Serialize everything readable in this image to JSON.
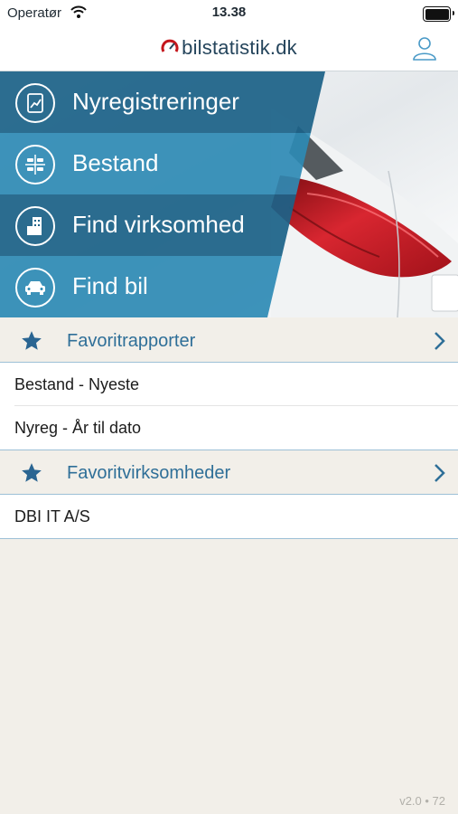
{
  "status_bar": {
    "carrier": "Operatør",
    "time": "13.38",
    "wifi_icon": "wifi-icon",
    "battery_icon": "battery-icon"
  },
  "nav": {
    "title": "bilstatistik.dk",
    "logo_icon": "speedometer-icon",
    "user_icon": "user-icon"
  },
  "menu": {
    "items": [
      {
        "label": "Nyregistreringer",
        "icon": "report-chart-icon"
      },
      {
        "label": "Bestand",
        "icon": "cars-grid-icon"
      },
      {
        "label": "Find virksomhed",
        "icon": "building-icon"
      },
      {
        "label": "Find bil",
        "icon": "car-icon"
      }
    ]
  },
  "favorites": {
    "reports": {
      "title": "Favoritrapporter",
      "items": [
        "Bestand - Nyeste",
        "Nyreg - År til dato"
      ]
    },
    "companies": {
      "title": "Favoritvirksomheder",
      "items": [
        "DBI IT A/S"
      ]
    }
  },
  "footer": {
    "version": "v2.0 • 72"
  },
  "colors": {
    "menu_dark": "#1c6288",
    "menu_light": "#2e8ab4",
    "section_title": "#2f6f98",
    "background": "#f2efe9"
  }
}
